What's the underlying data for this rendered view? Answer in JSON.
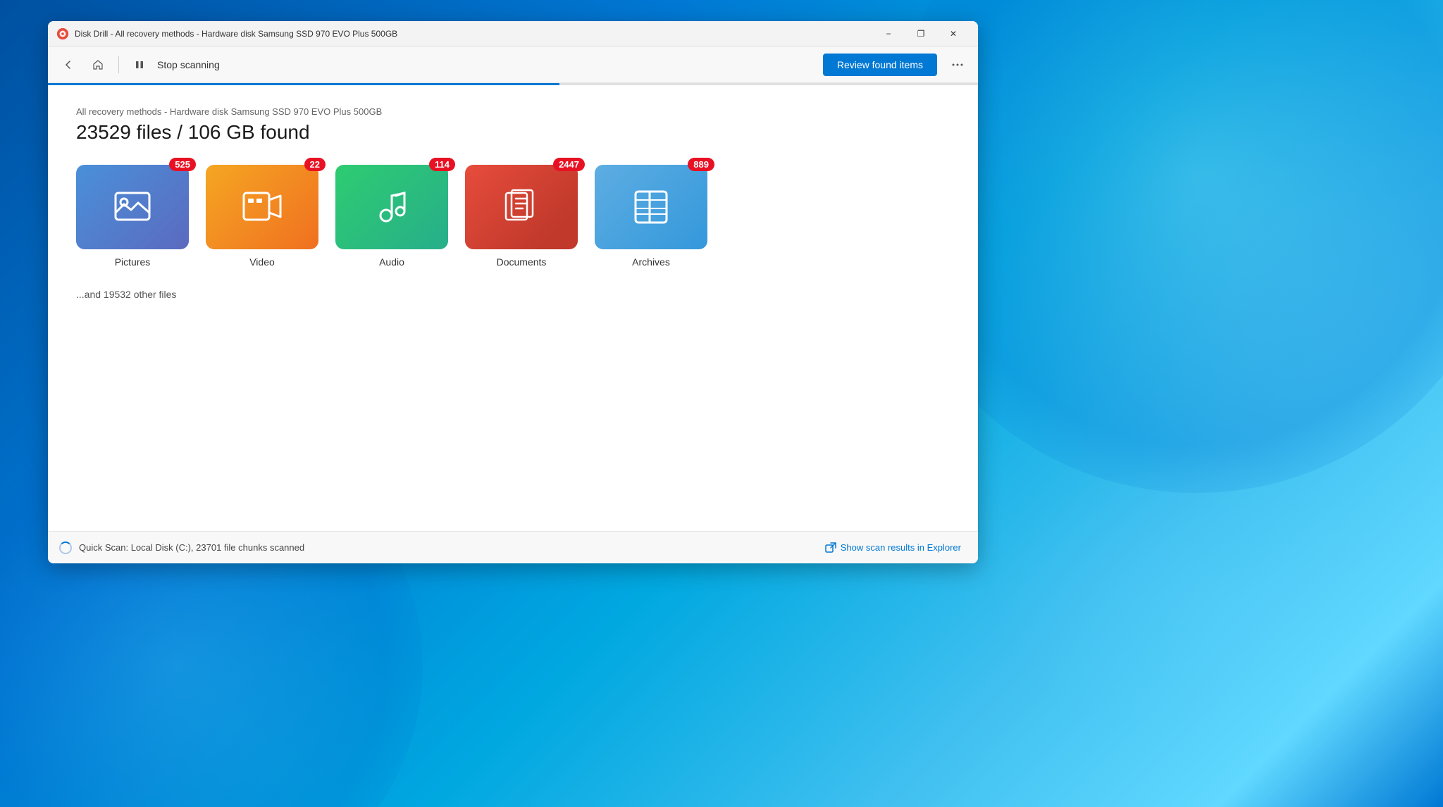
{
  "window": {
    "title": "Disk Drill - All recovery methods - Hardware disk Samsung SSD 970 EVO Plus 500GB",
    "icon_label": "disk-drill-icon"
  },
  "toolbar": {
    "scanning_label": "Stop scanning",
    "review_button_label": "Review found items",
    "more_button_label": "···"
  },
  "main": {
    "subtitle": "All recovery methods - Hardware disk Samsung SSD 970 EVO Plus 500GB",
    "title": "23529 files / 106 GB found",
    "other_files_text": "...and 19532 other files",
    "categories": [
      {
        "id": "pictures",
        "label": "Pictures",
        "count": "525",
        "icon": "picture-icon",
        "color_class": "card-pictures"
      },
      {
        "id": "video",
        "label": "Video",
        "count": "22",
        "icon": "video-icon",
        "color_class": "card-video"
      },
      {
        "id": "audio",
        "label": "Audio",
        "count": "114",
        "icon": "audio-icon",
        "color_class": "card-audio"
      },
      {
        "id": "documents",
        "label": "Documents",
        "count": "2447",
        "icon": "documents-icon",
        "color_class": "card-documents"
      },
      {
        "id": "archives",
        "label": "Archives",
        "count": "889",
        "icon": "archives-icon",
        "color_class": "card-archives"
      }
    ]
  },
  "status_bar": {
    "text": "Quick Scan: Local Disk (C:), 23701 file chunks scanned",
    "show_in_explorer_label": "Show scan results in Explorer"
  },
  "window_controls": {
    "minimize": "−",
    "restore": "❐",
    "close": "✕"
  }
}
